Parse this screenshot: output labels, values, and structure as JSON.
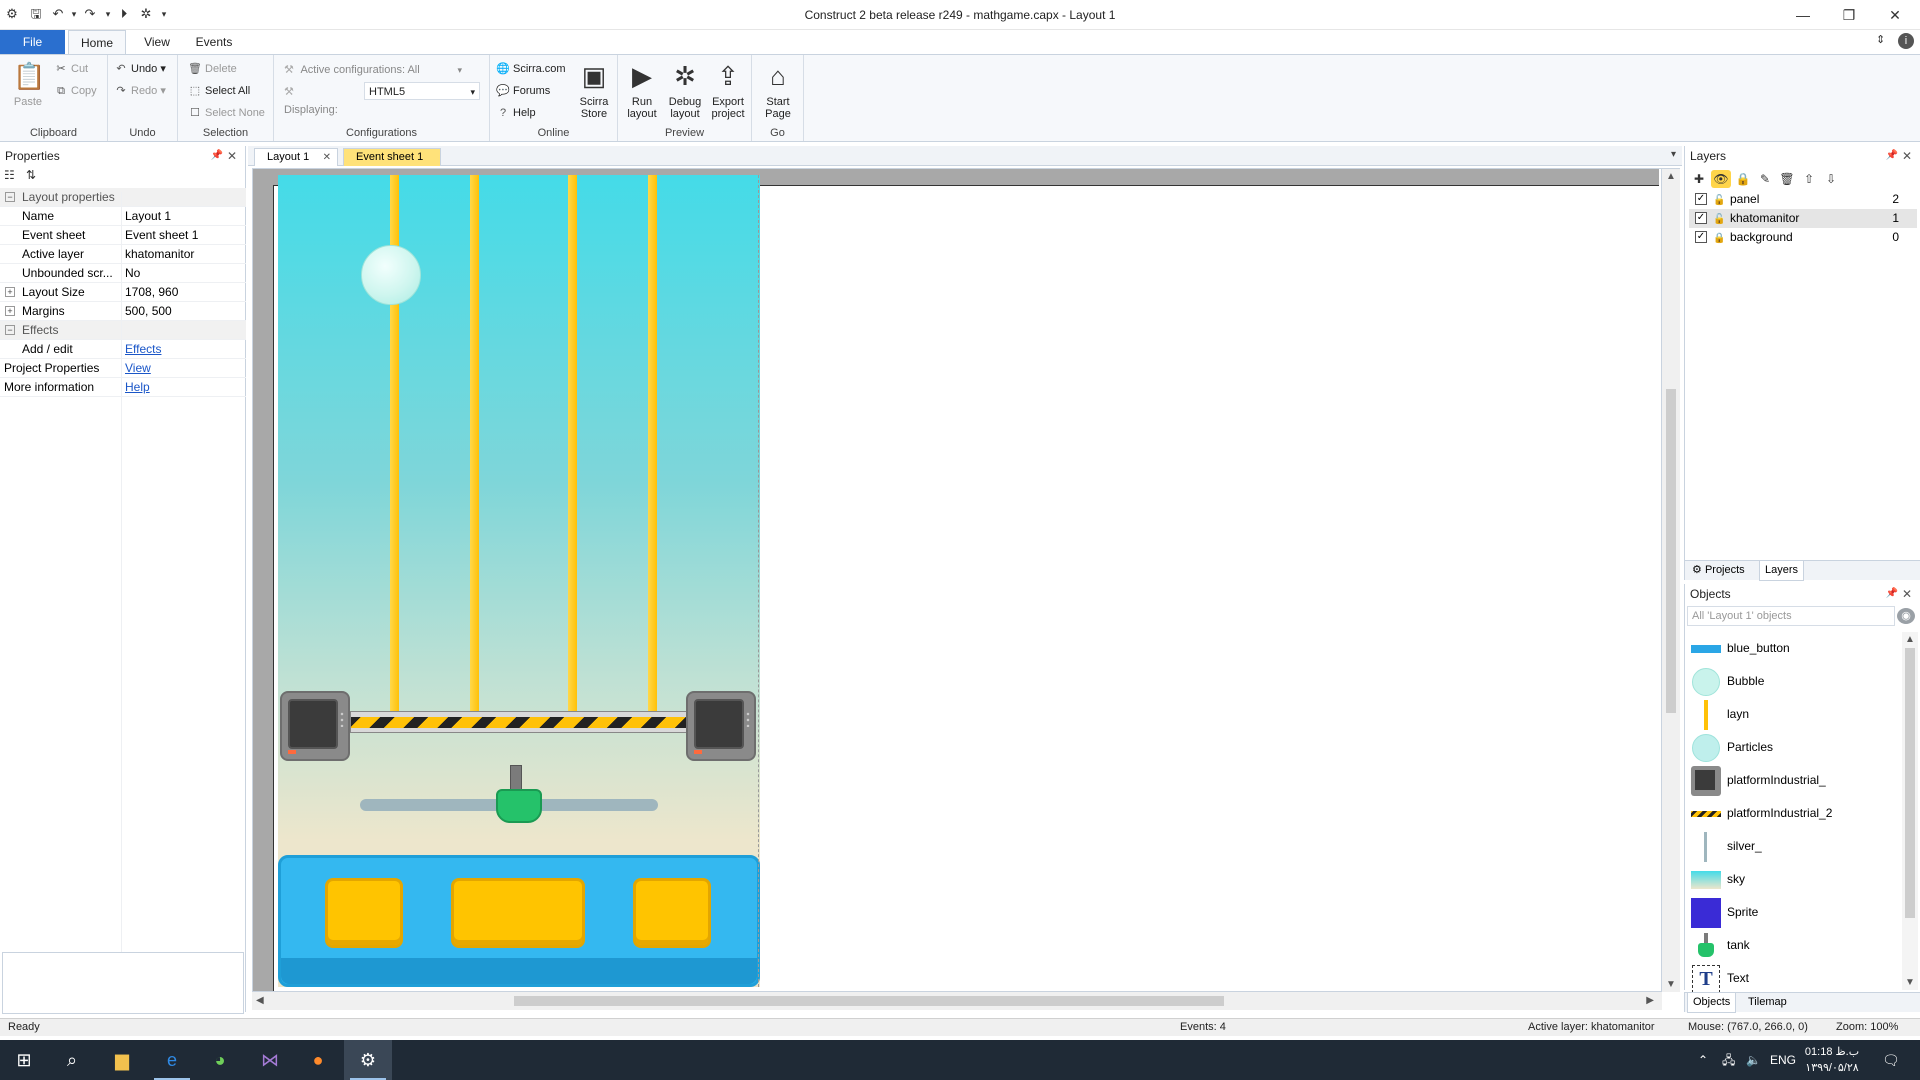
{
  "window": {
    "title": "Construct 2 beta release r249 - mathgame.capx - Layout 1",
    "minimize": "—",
    "maximize": "❐",
    "close": "✕"
  },
  "ribbon_tabs": {
    "file": "File",
    "home": "Home",
    "view": "View",
    "events": "Events"
  },
  "ribbon": {
    "clipboard": {
      "label": "Clipboard",
      "paste": "Paste",
      "cut": "Cut",
      "copy": "Copy"
    },
    "undo": {
      "label": "Undo",
      "undo": "Undo",
      "redo": "Redo"
    },
    "selection": {
      "label": "Selection",
      "delete": "Delete",
      "select_all": "Select All",
      "select_none": "Select None"
    },
    "configurations": {
      "label": "Configurations",
      "active": "Active configurations: All",
      "displaying_label": "Displaying:",
      "displaying_value": "HTML5"
    },
    "online": {
      "label": "Online",
      "scirra": "Scirra.com",
      "forums": "Forums",
      "help": "Help",
      "store_line1": "Scirra",
      "store_line2": "Store"
    },
    "preview": {
      "label": "Preview",
      "run_line1": "Run",
      "run_line2": "layout",
      "debug_line1": "Debug",
      "debug_line2": "layout",
      "export_line1": "Export",
      "export_line2": "project"
    },
    "go": {
      "label": "Go",
      "start_line1": "Start",
      "start_line2": "Page"
    }
  },
  "properties": {
    "title": "Properties",
    "section_layout": "Layout properties",
    "rows": [
      {
        "key": "Name",
        "value": "Layout 1"
      },
      {
        "key": "Event sheet",
        "value": "Event sheet 1"
      },
      {
        "key": "Active layer",
        "value": "khatomanitor"
      },
      {
        "key": "Unbounded scr...",
        "value": "No"
      },
      {
        "key": "Layout Size",
        "value": "1708, 960"
      },
      {
        "key": "Margins",
        "value": "500, 500"
      }
    ],
    "section_effects": "Effects",
    "add_edit": {
      "key": "Add / edit",
      "value": "Effects"
    },
    "project_properties": {
      "key": "Project Properties",
      "value": "View"
    },
    "more_information": {
      "key": "More information",
      "value": "Help"
    }
  },
  "doc_tabs": {
    "layout": "Layout 1",
    "event_sheet": "Event sheet 1"
  },
  "layers": {
    "title": "Layers",
    "items": [
      {
        "name": "panel",
        "index": "2"
      },
      {
        "name": "khatomanitor",
        "index": "1"
      },
      {
        "name": "background",
        "index": "0"
      }
    ],
    "tabs": {
      "projects": "Projects",
      "layers": "Layers"
    }
  },
  "objects": {
    "title": "Objects",
    "search_placeholder": "All 'Layout 1' objects",
    "items": [
      {
        "name": "blue_button"
      },
      {
        "name": "Bubble"
      },
      {
        "name": "layn"
      },
      {
        "name": "Particles"
      },
      {
        "name": "platformIndustrial_"
      },
      {
        "name": "platformIndustrial_2"
      },
      {
        "name": "silver_"
      },
      {
        "name": "sky"
      },
      {
        "name": "Sprite"
      },
      {
        "name": "tank"
      },
      {
        "name": "Text"
      }
    ],
    "tabs": {
      "objects": "Objects",
      "tilemap": "Tilemap"
    }
  },
  "status": {
    "ready": "Ready",
    "events": "Events: 4",
    "active_layer": "Active layer: khatomanitor",
    "mouse": "Mouse: (767.0, 266.0, 0)",
    "zoom": "Zoom: 100%"
  },
  "taskbar": {
    "lang": "ENG",
    "time": "01:18 ب.ظ",
    "date": "۱۳۹۹/۰۵/۲۸"
  }
}
